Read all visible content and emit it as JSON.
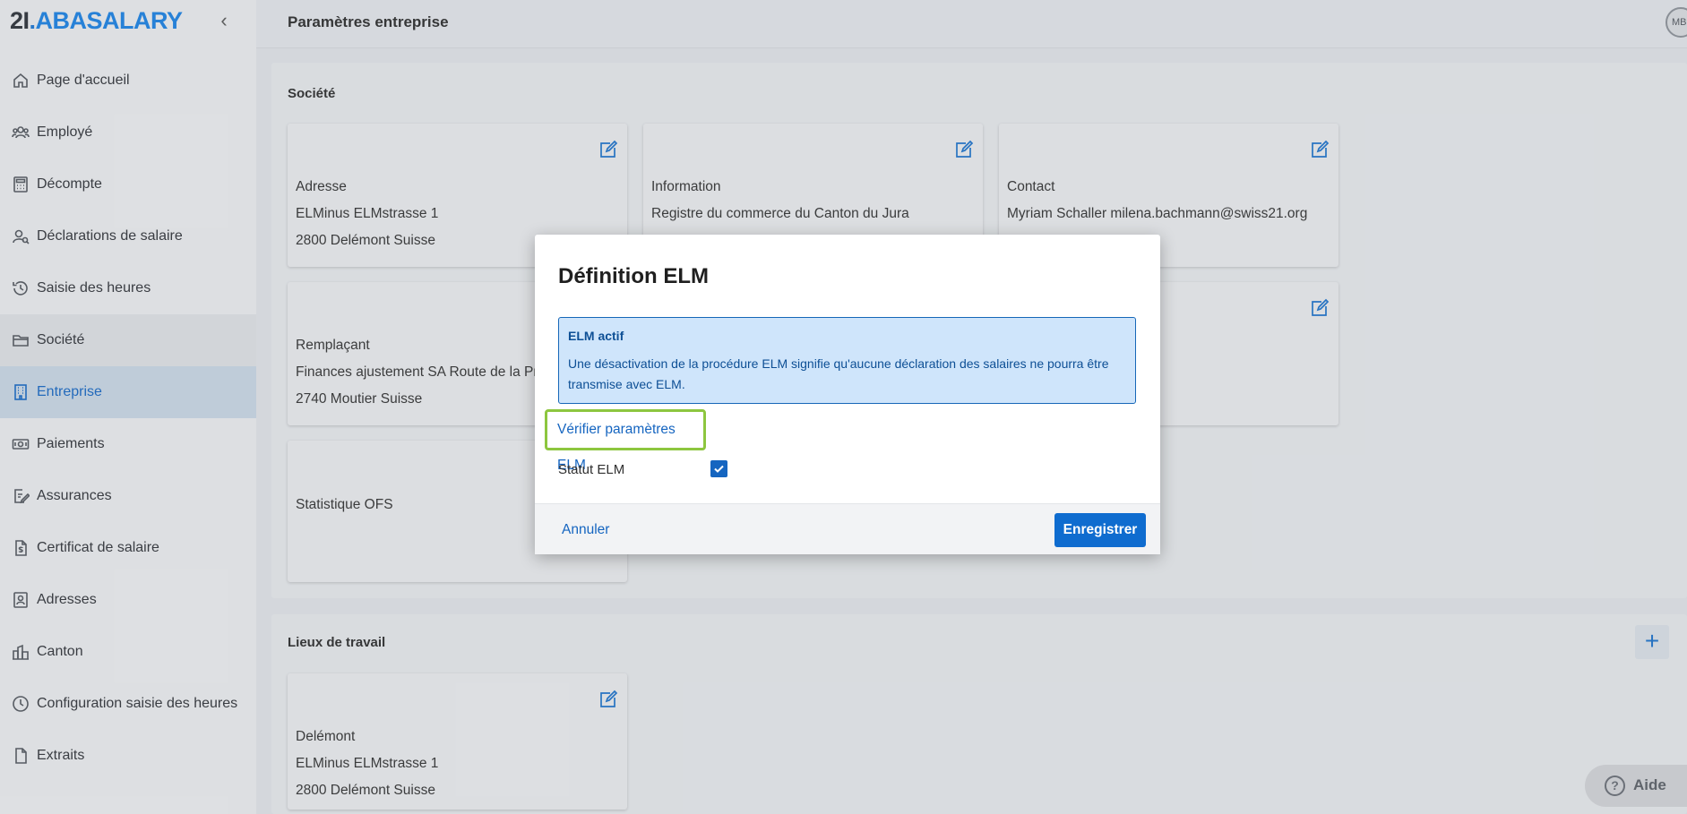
{
  "app": {
    "logo_prefix": "2I",
    "logo_dot": ".",
    "logo_name": "ABASALARY"
  },
  "header": {
    "title": "Paramètres entreprise",
    "avatar": "MBB"
  },
  "sidebar": {
    "items": [
      {
        "label": "Page d'accueil",
        "icon": "home-icon"
      },
      {
        "label": "Employé",
        "icon": "people-icon"
      },
      {
        "label": "Décompte",
        "icon": "calculator-icon"
      },
      {
        "label": "Déclarations de salaire",
        "icon": "person-search-icon"
      },
      {
        "label": "Saisie des heures",
        "icon": "history-icon"
      },
      {
        "label": "Société",
        "icon": "folder-icon"
      },
      {
        "label": "Entreprise",
        "icon": "building-icon"
      },
      {
        "label": "Paiements",
        "icon": "banknote-icon"
      },
      {
        "label": "Assurances",
        "icon": "document-edit-icon"
      },
      {
        "label": "Certificat de salaire",
        "icon": "money-document-icon"
      },
      {
        "label": "Adresses",
        "icon": "contact-card-icon"
      },
      {
        "label": "Canton",
        "icon": "city-icon"
      },
      {
        "label": "Configuration saisie des heures",
        "icon": "clock-icon"
      },
      {
        "label": "Extraits",
        "icon": "file-icon"
      }
    ]
  },
  "societe": {
    "title": "Société",
    "cards": [
      {
        "t1": "Adresse",
        "t2": "ELMinus  ELMstrasse 1",
        "t3": "2800 Delémont  Suisse"
      },
      {
        "t1": "Information",
        "t2": "Registre du commerce du Canton du Jura",
        "t3": ""
      },
      {
        "t1": "Contact",
        "t2": "Myriam Schaller  milena.bachmann@swiss21.org",
        "t3": ""
      },
      {
        "t1": "Remplaçant",
        "t2": "Finances ajustement SA  Route de la Pr",
        "t3": "2740 Moutier  Suisse"
      },
      {
        "t1": "",
        "t2": "",
        "t3": ""
      },
      {
        "t1": "Statistique OFS",
        "t2": "",
        "t3": ""
      }
    ]
  },
  "lieux": {
    "title": "Lieux de travail",
    "add_label": "+",
    "cards": [
      {
        "t1": "Delémont",
        "t2": "ELMinus  ELMstrasse 1",
        "t3": "2800 Delémont  Suisse"
      }
    ]
  },
  "modal": {
    "title": "Définition ELM",
    "info_title": "ELM actif",
    "info_text": "Une désactivation de la procédure ELM signifie qu'aucune déclaration des salaires ne pourra être transmise avec ELM.",
    "verify_link": "Vérifier paramètres ELM",
    "status_label": "Statut ELM",
    "status_checked": true,
    "cancel": "Annuler",
    "save": "Enregistrer"
  },
  "help": {
    "label": "Aide",
    "icon": "?"
  },
  "colors": {
    "accent": "#1565c0",
    "brand": "#1a7fe0",
    "highlight": "#8dc63f",
    "info_bg": "#cfe5fb"
  }
}
